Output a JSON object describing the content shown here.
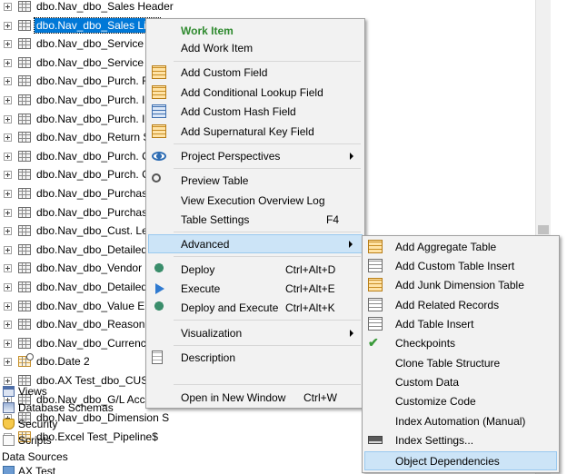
{
  "tree": {
    "tables": [
      {
        "label": "dbo.Nav_dbo_Sales Header",
        "selected": false
      },
      {
        "label": "dbo.Nav_dbo_Sales Line",
        "selected": true
      },
      {
        "label": "dbo.Nav_dbo_Service Hea",
        "selected": false
      },
      {
        "label": "dbo.Nav_dbo_Service Line",
        "selected": false
      },
      {
        "label": "dbo.Nav_dbo_Purch. Rcpt",
        "selected": false
      },
      {
        "label": "dbo.Nav_dbo_Purch. Inv.",
        "selected": false
      },
      {
        "label": "dbo.Nav_dbo_Purch. Inv.",
        "selected": false
      },
      {
        "label": "dbo.Nav_dbo_Return Ship",
        "selected": false
      },
      {
        "label": "dbo.Nav_dbo_Purch. Cr. M",
        "selected": false
      },
      {
        "label": "dbo.Nav_dbo_Purch. Cr. M",
        "selected": false
      },
      {
        "label": "dbo.Nav_dbo_Purchase H",
        "selected": false
      },
      {
        "label": "dbo.Nav_dbo_Purchase Li",
        "selected": false
      },
      {
        "label": "dbo.Nav_dbo_Cust. Ledge",
        "selected": false
      },
      {
        "label": "dbo.Nav_dbo_Detailed Cu",
        "selected": false
      },
      {
        "label": "dbo.Nav_dbo_Vendor Led",
        "selected": false
      },
      {
        "label": "dbo.Nav_dbo_Detailed Ve",
        "selected": false
      },
      {
        "label": "dbo.Nav_dbo_Value Entry",
        "selected": false
      },
      {
        "label": "dbo.Nav_dbo_Reason Coc",
        "selected": false
      },
      {
        "label": "dbo.Nav_dbo_Currency Ex",
        "selected": false
      },
      {
        "label": "dbo.Date 2",
        "selected": false
      },
      {
        "label": "dbo.AX Test_dbo_CUSTT",
        "selected": false
      },
      {
        "label": "dbo.Nav_dbo_G/L Accour",
        "selected": false
      },
      {
        "label": "dbo.Nav_dbo_Dimension S",
        "selected": false
      },
      {
        "label": "dbo.Excel Test_Pipeline$",
        "selected": false
      }
    ],
    "views": "Views",
    "database_schemas": "Database Schemas",
    "security": "Security",
    "scripts": "Scripts",
    "data_sources": "Data Sources",
    "ax_test": "AX Test"
  },
  "context_menu": {
    "title": "Work Item",
    "add_work_item": "Add Work Item",
    "add_custom_field": "Add Custom Field",
    "add_conditional_lookup_field": "Add Conditional Lookup Field",
    "add_custom_hash_field": "Add Custom Hash Field",
    "add_supernatural_key_field": "Add Supernatural Key Field",
    "project_perspectives": "Project Perspectives",
    "preview_table": "Preview Table",
    "view_execution_overview_log": "View Execution Overview Log",
    "table_settings": "Table Settings",
    "table_settings_shortcut": "F4",
    "advanced": "Advanced",
    "deploy": "Deploy",
    "deploy_shortcut": "Ctrl+Alt+D",
    "execute": "Execute",
    "execute_shortcut": "Ctrl+Alt+E",
    "deploy_and_execute": "Deploy and Execute",
    "deploy_and_execute_shortcut": "Ctrl+Alt+K",
    "visualization": "Visualization",
    "description": "Description",
    "open_in_new_window": "Open in New Window",
    "open_in_new_window_shortcut": "Ctrl+W"
  },
  "advanced_submenu": {
    "add_aggregate_table": "Add Aggregate Table",
    "add_custom_table_insert": "Add Custom Table Insert",
    "add_junk_dimension_table": "Add Junk Dimension Table",
    "add_related_records": "Add Related Records",
    "add_table_insert": "Add Table Insert",
    "checkpoints": "Checkpoints",
    "clone_table_structure": "Clone Table Structure",
    "custom_data": "Custom Data",
    "customize_code": "Customize Code",
    "index_automation": "Index Automation (Manual)",
    "index_settings": "Index Settings...",
    "object_dependencies": "Object Dependencies"
  },
  "colors": {
    "selection": "#0078d7",
    "menu_highlight": "#cce4f7",
    "title_green": "#2f8a2f"
  }
}
